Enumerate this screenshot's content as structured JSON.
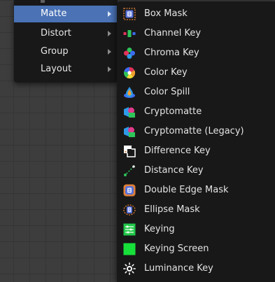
{
  "parent_menu": {
    "items": [
      {
        "label": "Matte",
        "active": true
      },
      {
        "label": "Distort",
        "active": false
      },
      {
        "label": "Group",
        "active": false
      },
      {
        "label": "Layout",
        "active": false
      }
    ]
  },
  "submenu": {
    "items": [
      {
        "label": "Box Mask",
        "icon": "box-mask-icon"
      },
      {
        "label": "Channel Key",
        "icon": "channel-key-icon"
      },
      {
        "label": "Chroma Key",
        "icon": "chroma-key-icon"
      },
      {
        "label": "Color Key",
        "icon": "color-key-icon"
      },
      {
        "label": "Color Spill",
        "icon": "color-spill-icon"
      },
      {
        "label": "Cryptomatte",
        "icon": "cryptomatte-icon"
      },
      {
        "label": "Cryptomatte (Legacy)",
        "icon": "cryptomatte-legacy-icon"
      },
      {
        "label": "Difference Key",
        "icon": "difference-key-icon"
      },
      {
        "label": "Distance Key",
        "icon": "distance-key-icon"
      },
      {
        "label": "Double Edge Mask",
        "icon": "double-edge-mask-icon"
      },
      {
        "label": "Ellipse Mask",
        "icon": "ellipse-mask-icon"
      },
      {
        "label": "Keying",
        "icon": "keying-icon"
      },
      {
        "label": "Keying Screen",
        "icon": "keying-screen-icon"
      },
      {
        "label": "Luminance Key",
        "icon": "luminance-key-icon"
      }
    ]
  },
  "colors": {
    "menu_bg": "#181818",
    "highlight": "#4a72b5",
    "canvas_bg": "#3d3d3d",
    "grid_line": "#353535"
  }
}
